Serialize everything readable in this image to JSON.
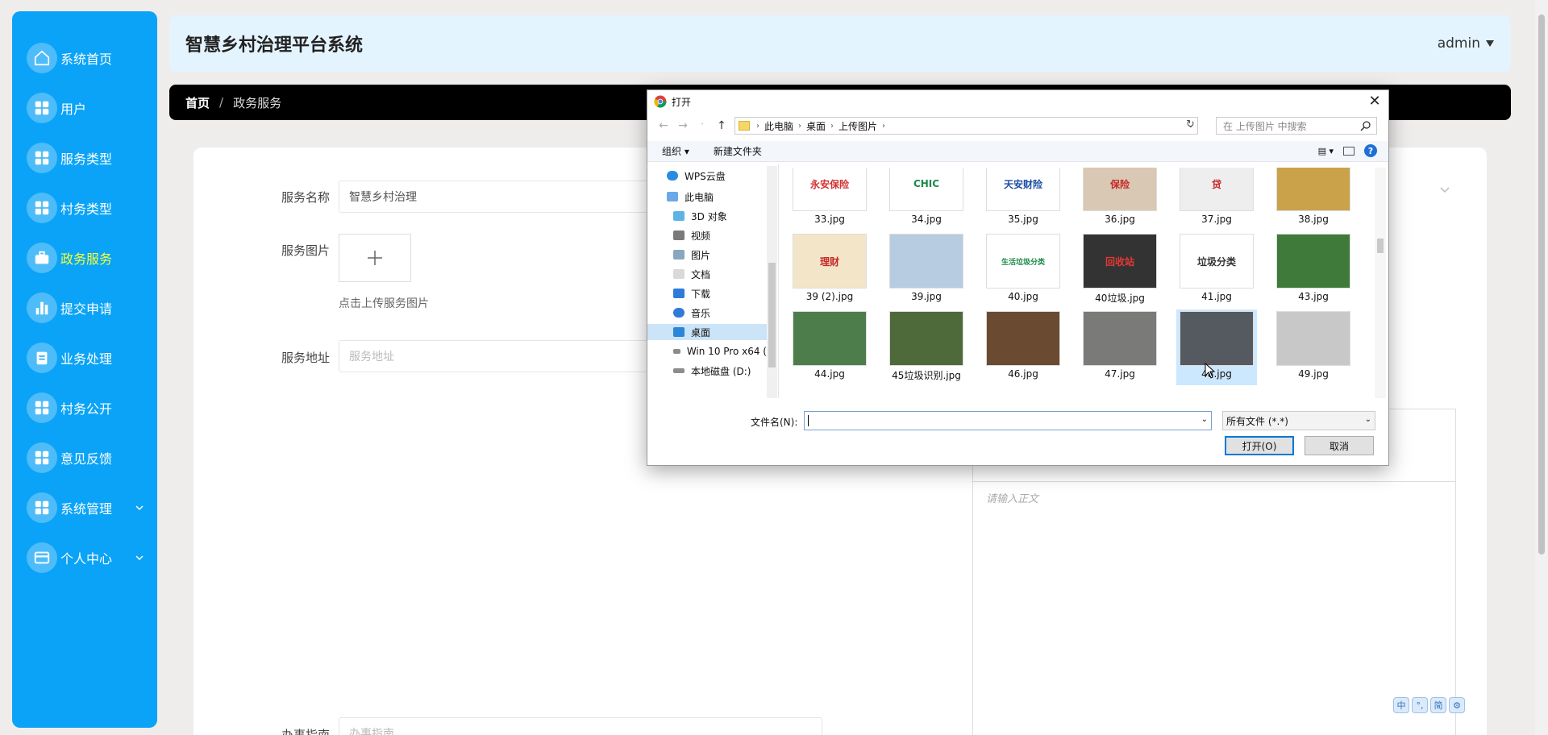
{
  "sidebar": {
    "items": [
      {
        "label": "系统首页",
        "icon": "home-icon"
      },
      {
        "label": "用户",
        "icon": "grid-icon"
      },
      {
        "label": "服务类型",
        "icon": "grid-icon"
      },
      {
        "label": "村务类型",
        "icon": "grid-icon"
      },
      {
        "label": "政务服务",
        "icon": "briefcase-icon",
        "active": true
      },
      {
        "label": "提交申请",
        "icon": "bar-chart-icon"
      },
      {
        "label": "业务处理",
        "icon": "clipboard-icon"
      },
      {
        "label": "村务公开",
        "icon": "grid-icon"
      },
      {
        "label": "意见反馈",
        "icon": "grid-icon"
      },
      {
        "label": "系统管理",
        "icon": "grid-icon",
        "has_submenu": true
      },
      {
        "label": "个人中心",
        "icon": "card-icon",
        "has_submenu": true
      }
    ]
  },
  "header": {
    "title": "智慧乡村治理平台系统",
    "user": "admin"
  },
  "breadcrumb": {
    "home": "首页",
    "separator": "/",
    "current": "政务服务"
  },
  "form": {
    "service_name_label": "服务名称",
    "service_name_value": "智慧乡村治理",
    "service_image_label": "服务图片",
    "upload_tip": "点击上传服务图片",
    "address_label": "服务地址",
    "address_placeholder": "服务地址",
    "guide_label": "办事指南",
    "guide_placeholder": "办事指南",
    "editor_placeholder": "请输入正文"
  },
  "dialog": {
    "title": "打开",
    "path": [
      "此电脑",
      "桌面",
      "上传图片"
    ],
    "search_placeholder": "在 上传图片 中搜索",
    "toolbar": {
      "organize": "组织 ▾",
      "new_folder": "新建文件夹"
    },
    "tree": [
      "WPS云盘",
      "此电脑",
      "3D 对象",
      "视频",
      "图片",
      "文档",
      "下载",
      "音乐",
      "桌面",
      "Win 10 Pro x64 (",
      "本地磁盘 (D:)"
    ],
    "files": [
      {
        "name": "33.jpg",
        "thumb_text": "永安保险"
      },
      {
        "name": "34.jpg",
        "thumb_text": "CHIC"
      },
      {
        "name": "35.jpg",
        "thumb_text": "天安财险"
      },
      {
        "name": "36.jpg",
        "thumb_text": "保险"
      },
      {
        "name": "37.jpg",
        "thumb_text": "贷"
      },
      {
        "name": "38.jpg",
        "thumb_text": ""
      },
      {
        "name": "39 (2).jpg",
        "thumb_text": "理财"
      },
      {
        "name": "39.jpg",
        "thumb_text": ""
      },
      {
        "name": "40.jpg",
        "thumb_text": "生活垃圾分类"
      },
      {
        "name": "40垃圾.jpg",
        "thumb_text": "回收站"
      },
      {
        "name": "41.jpg",
        "thumb_text": "垃圾分类"
      },
      {
        "name": "43.jpg",
        "thumb_text": ""
      },
      {
        "name": "44.jpg",
        "thumb_text": ""
      },
      {
        "name": "45垃圾识别.jpg",
        "thumb_text": ""
      },
      {
        "name": "46.jpg",
        "thumb_text": ""
      },
      {
        "name": "47.jpg",
        "thumb_text": ""
      },
      {
        "name": "48.jpg",
        "thumb_text": "",
        "selected": true
      },
      {
        "name": "49.jpg",
        "thumb_text": ""
      }
    ],
    "filename_label": "文件名(N):",
    "filename_value": "",
    "filter_value": "所有文件 (*.*)",
    "open_button": "打开(O)",
    "cancel_button": "取消"
  },
  "ime": [
    "中",
    "°,",
    "简",
    "⚙"
  ],
  "colors": {
    "sidebar": "#0aa3f7",
    "active_nav": "#f7ff3b",
    "header_bg": "#e4f4ff",
    "breadcrumb_bg": "#000000"
  }
}
